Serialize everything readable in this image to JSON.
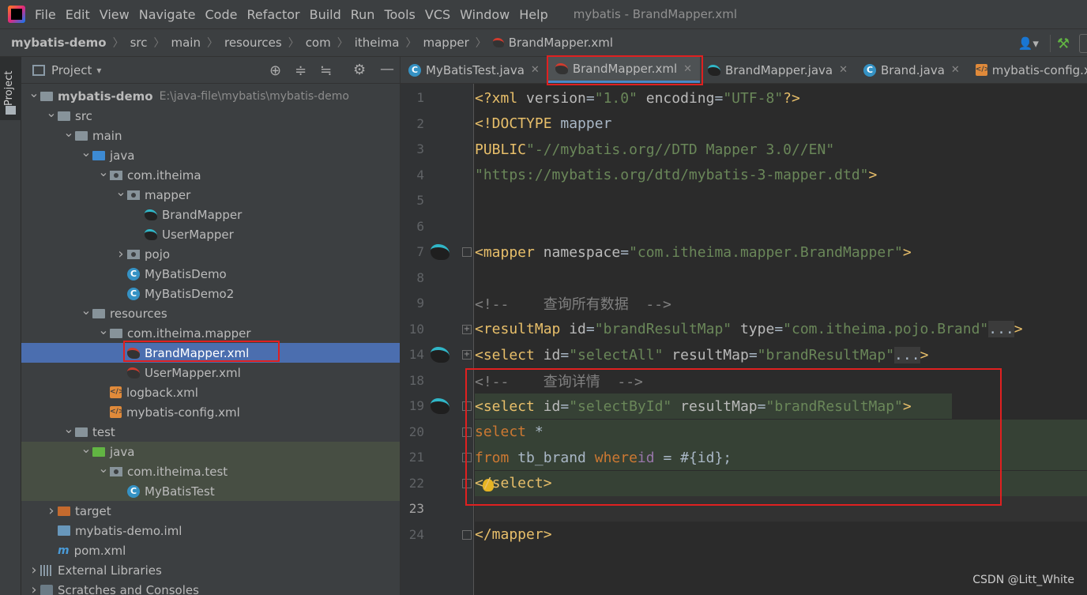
{
  "menubar": {
    "items": [
      "File",
      "Edit",
      "View",
      "Navigate",
      "Code",
      "Refactor",
      "Build",
      "Run",
      "Tools",
      "VCS",
      "Window",
      "Help"
    ],
    "title": "mybatis - BrandMapper.xml"
  },
  "breadcrumb": [
    "mybatis-demo",
    "src",
    "main",
    "resources",
    "com",
    "itheima",
    "mapper",
    "BrandMapper.xml"
  ],
  "project_panel": {
    "title": "Project",
    "tree": [
      {
        "label": "mybatis-demo",
        "extra": "E:\\java-file\\mybatis\\mybatis-demo",
        "indent": 0,
        "arrow": "v",
        "icon": "module-folder",
        "bold": true
      },
      {
        "label": "src",
        "indent": 1,
        "arrow": "v",
        "icon": "folder"
      },
      {
        "label": "main",
        "indent": 2,
        "arrow": "v",
        "icon": "folder"
      },
      {
        "label": "java",
        "indent": 3,
        "arrow": "v",
        "icon": "folder-blue"
      },
      {
        "label": "com.itheima",
        "indent": 4,
        "arrow": "v",
        "icon": "package"
      },
      {
        "label": "mapper",
        "indent": 5,
        "arrow": "v",
        "icon": "package"
      },
      {
        "label": "BrandMapper",
        "indent": 6,
        "icon": "mybatis-bird"
      },
      {
        "label": "UserMapper",
        "indent": 6,
        "icon": "mybatis-bird"
      },
      {
        "label": "pojo",
        "indent": 5,
        "arrow": ">",
        "icon": "package"
      },
      {
        "label": "MyBatisDemo",
        "indent": 5,
        "icon": "class"
      },
      {
        "label": "MyBatisDemo2",
        "indent": 5,
        "icon": "class"
      },
      {
        "label": "resources",
        "indent": 3,
        "arrow": "v",
        "icon": "folder-res"
      },
      {
        "label": "com.itheima.mapper",
        "indent": 4,
        "arrow": "v",
        "icon": "folder"
      },
      {
        "label": "BrandMapper.xml",
        "indent": 5,
        "icon": "mybatis-xml",
        "selected": true
      },
      {
        "label": "UserMapper.xml",
        "indent": 5,
        "icon": "mybatis-xml"
      },
      {
        "label": "logback.xml",
        "indent": 4,
        "icon": "xml"
      },
      {
        "label": "mybatis-config.xml",
        "indent": 4,
        "icon": "xml"
      },
      {
        "label": "test",
        "indent": 2,
        "arrow": "v",
        "icon": "folder"
      },
      {
        "label": "java",
        "indent": 3,
        "arrow": "v",
        "icon": "folder-green",
        "green": true
      },
      {
        "label": "com.itheima.test",
        "indent": 4,
        "arrow": "v",
        "icon": "package",
        "green": true
      },
      {
        "label": "MyBatisTest",
        "indent": 5,
        "icon": "class",
        "green": true
      },
      {
        "label": "target",
        "indent": 1,
        "arrow": ">",
        "icon": "folder-orange"
      },
      {
        "label": "mybatis-demo.iml",
        "indent": 1,
        "icon": "module-file"
      },
      {
        "label": "pom.xml",
        "indent": 1,
        "icon": "maven"
      },
      {
        "label": "External Libraries",
        "indent": 0,
        "arrow": ">",
        "icon": "libraries"
      },
      {
        "label": "Scratches and Consoles",
        "indent": 0,
        "arrow": ">",
        "icon": "consoles"
      }
    ]
  },
  "tabs": [
    {
      "label": "MyBatisTest.java",
      "icon": "class"
    },
    {
      "label": "BrandMapper.xml",
      "icon": "mybatis-xml",
      "active": true
    },
    {
      "label": "BrandMapper.java",
      "icon": "mybatis-bird"
    },
    {
      "label": "Brand.java",
      "icon": "class"
    },
    {
      "label": "mybatis-config.xml",
      "icon": "xml"
    }
  ],
  "editor": {
    "lines": [
      {
        "num": "1",
        "code": "<?xml version=\"1.0\" encoding=\"UTF-8\" ?>"
      },
      {
        "num": "2",
        "code": "<!DOCTYPE mapper"
      },
      {
        "num": "3",
        "code": "        PUBLIC \"-//mybatis.org//DTD Mapper 3.0//EN\""
      },
      {
        "num": "4",
        "code": "        \"https://mybatis.org/dtd/mybatis-3-mapper.dtd\">"
      },
      {
        "num": "5",
        "code": ""
      },
      {
        "num": "6",
        "code": ""
      },
      {
        "num": "7",
        "code": "<mapper namespace=\"com.itheima.mapper.BrandMapper\">"
      },
      {
        "num": "8",
        "code": ""
      },
      {
        "num": "9",
        "code": "<!--    查询所有数据  -->"
      },
      {
        "num": "10",
        "code": "    <resultMap id=\"brandResultMap\" type=\"com.itheima.pojo.Brand\"...>"
      },
      {
        "num": "14",
        "code": "        <select id=\"selectAll\" resultMap=\"brandResultMap\"...>"
      },
      {
        "num": "18",
        "code": "<!--    查询详情  -->"
      },
      {
        "num": "19",
        "code": "    <select id=\"selectById\" resultMap=\"brandResultMap\">"
      },
      {
        "num": "20",
        "code": "        select *"
      },
      {
        "num": "21",
        "code": "        from tb_brand where id = #{id};"
      },
      {
        "num": "22",
        "code": "    </select>"
      },
      {
        "num": "23",
        "code": ""
      },
      {
        "num": "24",
        "code": "</mapper>"
      }
    ]
  },
  "watermark": "CSDN @Litt_White"
}
